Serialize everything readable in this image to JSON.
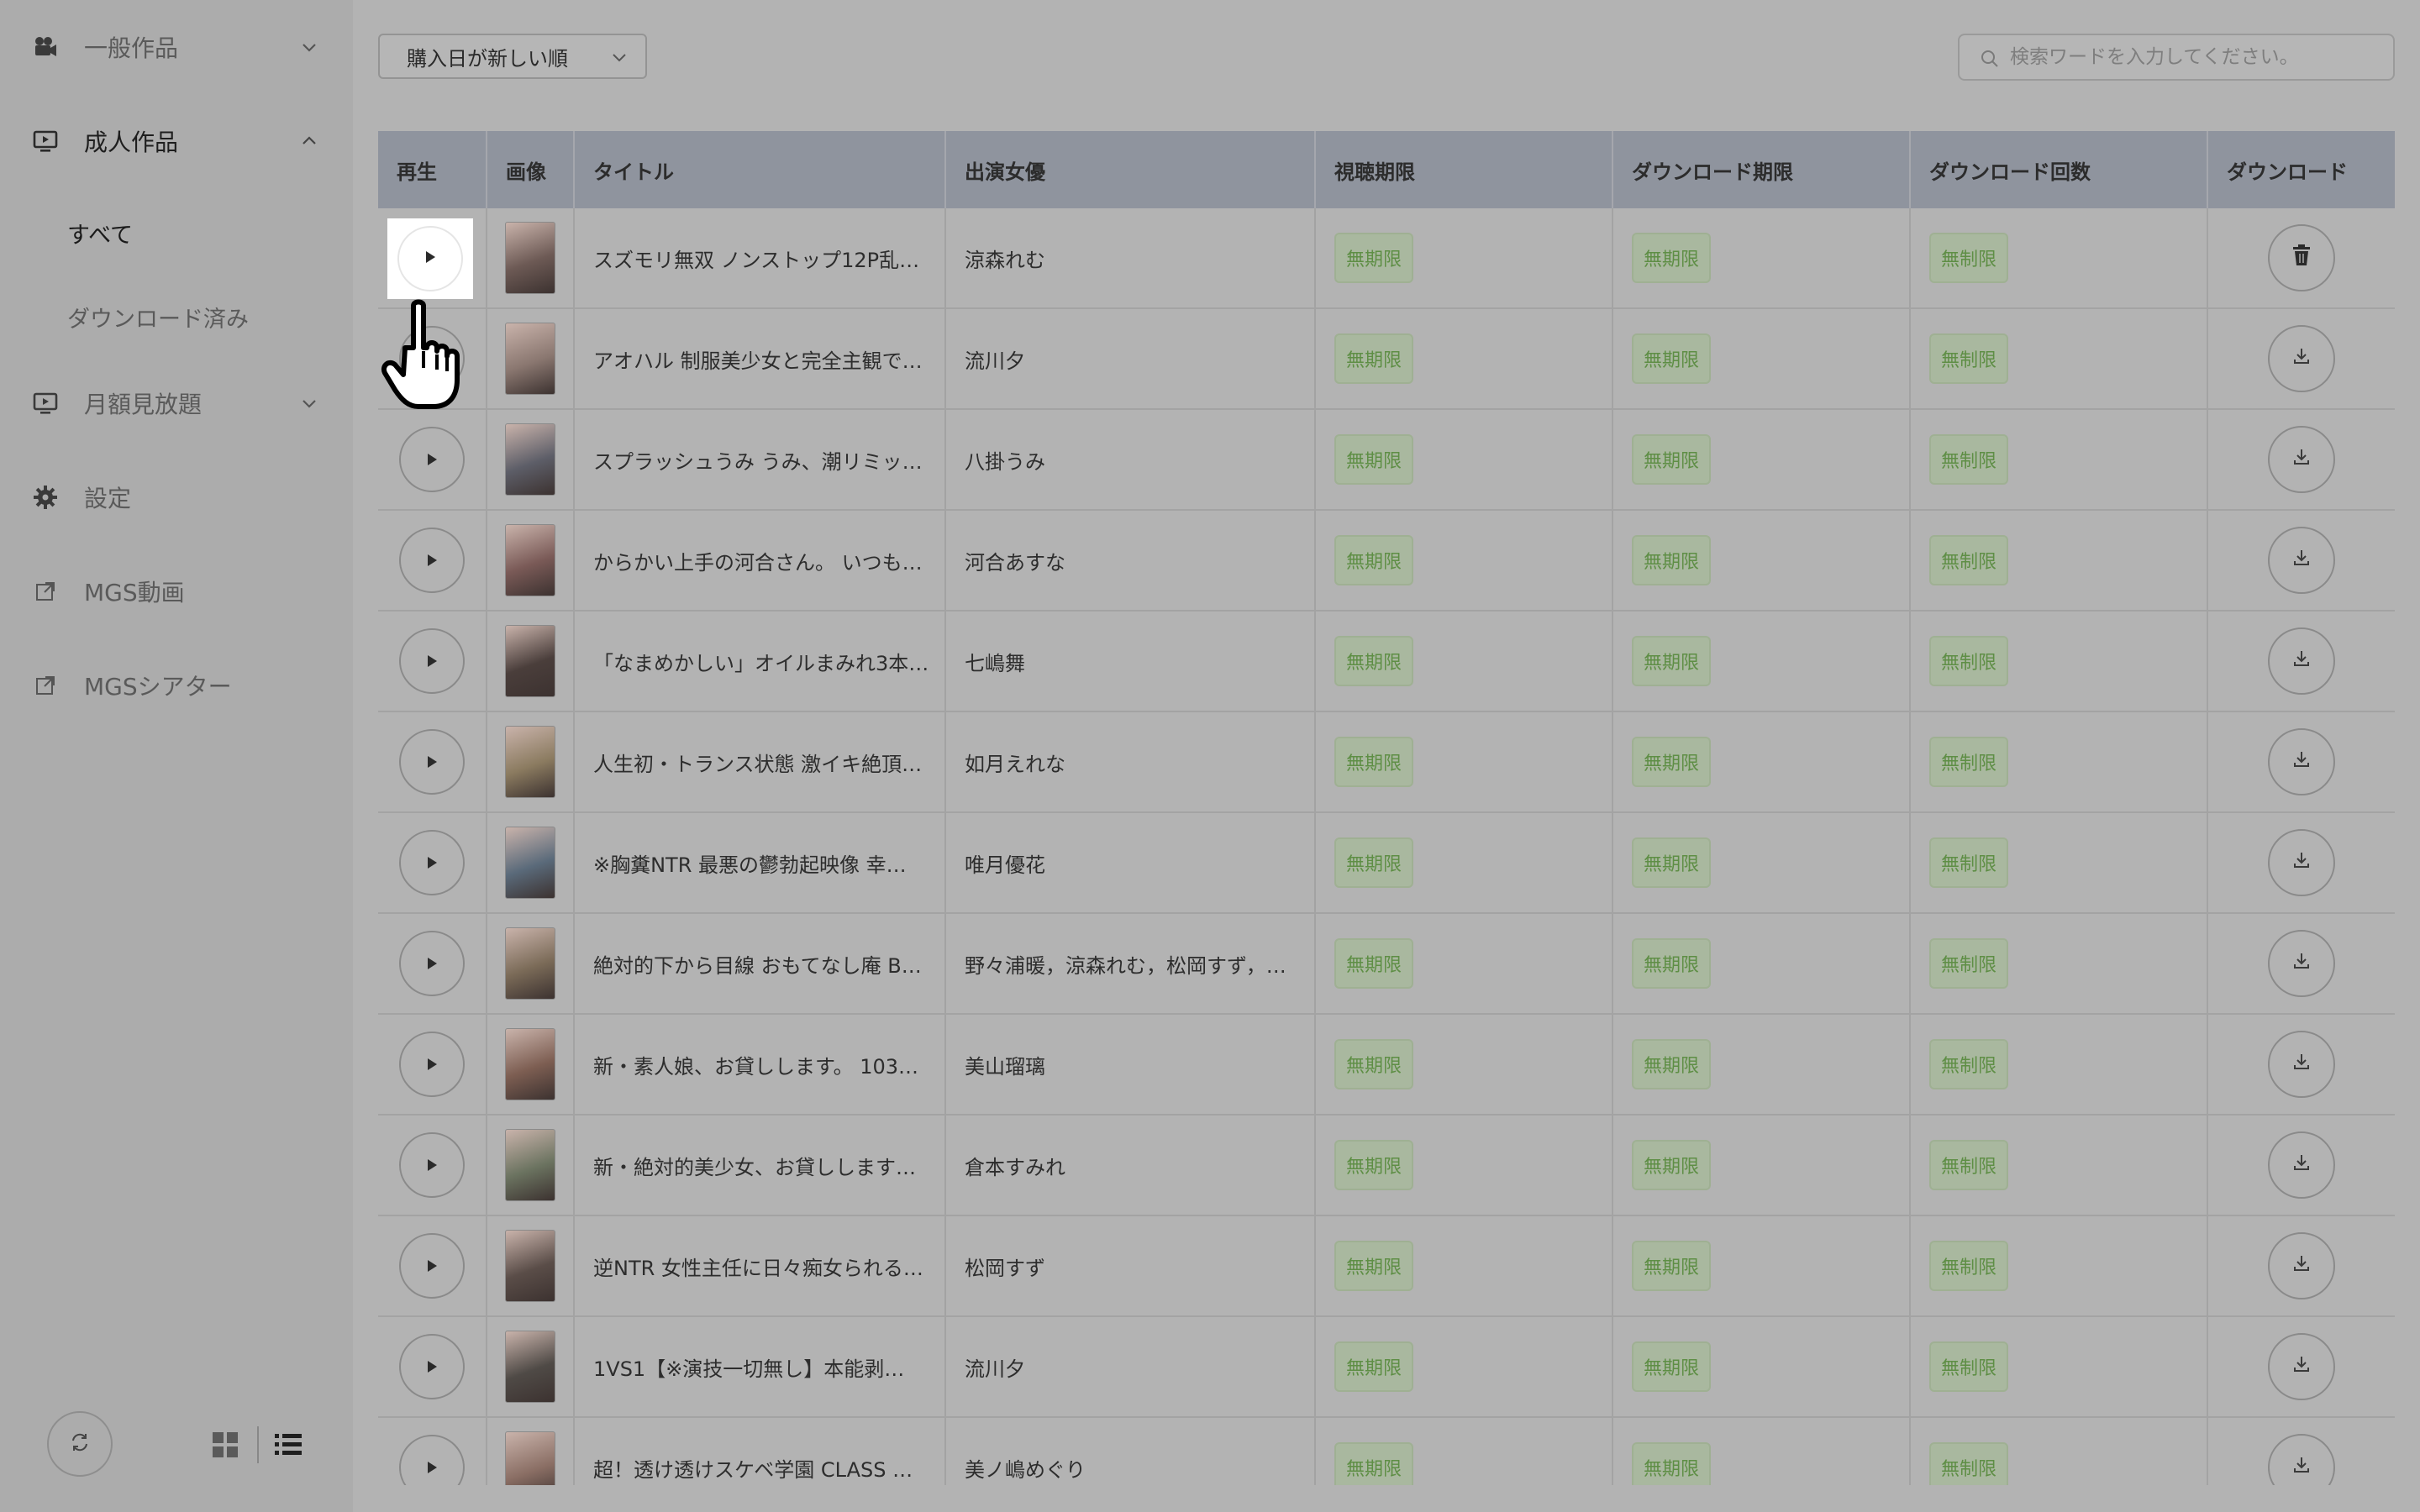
{
  "sidebar": {
    "items": [
      {
        "label": "一般作品",
        "icon": "video-camera-icon",
        "expanded": false
      },
      {
        "label": "成人作品",
        "icon": "monitor-icon",
        "expanded": true,
        "children": [
          {
            "label": "すべて",
            "active": true
          },
          {
            "label": "ダウンロード済み",
            "active": false
          }
        ]
      },
      {
        "label": "月額見放題",
        "icon": "monitor-icon",
        "expanded": false
      },
      {
        "label": "設定",
        "icon": "gear-icon"
      },
      {
        "label": "MGS動画",
        "icon": "external-link-icon"
      },
      {
        "label": "MGSシアター",
        "icon": "external-link-icon"
      }
    ],
    "footer": {
      "refresh": "refresh-icon",
      "grid_view": "grid-view-icon",
      "list_view": "list-view-icon"
    }
  },
  "toolbar": {
    "sort_value": "購入日が新しい順",
    "search_placeholder": "検索ワードを入力してください。"
  },
  "table": {
    "headers": [
      "再生",
      "画像",
      "タイトル",
      "出演女優",
      "視聴期限",
      "ダウンロード期限",
      "ダウンロード回数",
      "ダウンロード"
    ],
    "rows": [
      {
        "title": "スズモリ無双 ノンストップ12P乱…",
        "cast": "涼森れむ",
        "view": "無期限",
        "dl_period": "無期限",
        "dl_count": "無制限",
        "action": "trash"
      },
      {
        "title": "アオハル 制服美少女と完全主観で…",
        "cast": "流川夕",
        "view": "無期限",
        "dl_period": "無期限",
        "dl_count": "無制限",
        "action": "download"
      },
      {
        "title": "スプラッシュうみ うみ、潮リミッ…",
        "cast": "八掛うみ",
        "view": "無期限",
        "dl_period": "無期限",
        "dl_count": "無制限",
        "action": "download"
      },
      {
        "title": "からかい上手の河合さん。 いつも…",
        "cast": "河合あすな",
        "view": "無期限",
        "dl_period": "無期限",
        "dl_count": "無制限",
        "action": "download"
      },
      {
        "title": "「なまめかしい」オイルまみれ3本…",
        "cast": "七嶋舞",
        "view": "無期限",
        "dl_period": "無期限",
        "dl_count": "無制限",
        "action": "download"
      },
      {
        "title": "人生初・トランス状態 激イキ絶頂…",
        "cast": "如月えれな",
        "view": "無期限",
        "dl_period": "無期限",
        "dl_count": "無制限",
        "action": "download"
      },
      {
        "title": "※胸糞NTR 最悪の鬱勃起映像 幸…",
        "cast": "唯月優花",
        "view": "無期限",
        "dl_period": "無期限",
        "dl_count": "無制限",
        "action": "download"
      },
      {
        "title": "絶対的下から目線 おもてなし庵 B…",
        "cast": "野々浦暖，涼森れむ，松岡すず，…",
        "view": "無期限",
        "dl_period": "無期限",
        "dl_count": "無制限",
        "action": "download"
      },
      {
        "title": "新・素人娘、お貸しします。 103…",
        "cast": "美山瑠璃",
        "view": "無期限",
        "dl_period": "無期限",
        "dl_count": "無制限",
        "action": "download"
      },
      {
        "title": "新・絶対的美少女、お貸しします…",
        "cast": "倉本すみれ",
        "view": "無期限",
        "dl_period": "無期限",
        "dl_count": "無制限",
        "action": "download"
      },
      {
        "title": "逆NTR 女性主任に日々痴女られる…",
        "cast": "松岡すず",
        "view": "無期限",
        "dl_period": "無期限",
        "dl_count": "無制限",
        "action": "download"
      },
      {
        "title": "1VS1【※演技一切無し】本能剥…",
        "cast": "流川夕",
        "view": "無期限",
        "dl_period": "無期限",
        "dl_count": "無制限",
        "action": "download"
      },
      {
        "title": "超！透け透けスケベ学園 CLASS …",
        "cast": "美ノ嶋めぐり",
        "view": "無期限",
        "dl_period": "無期限",
        "dl_count": "無制限",
        "action": "download"
      }
    ]
  },
  "colors": {
    "badge_text": "#5e8e45",
    "header_bg": "#8f949e",
    "overlay": "#b3b3b3"
  }
}
